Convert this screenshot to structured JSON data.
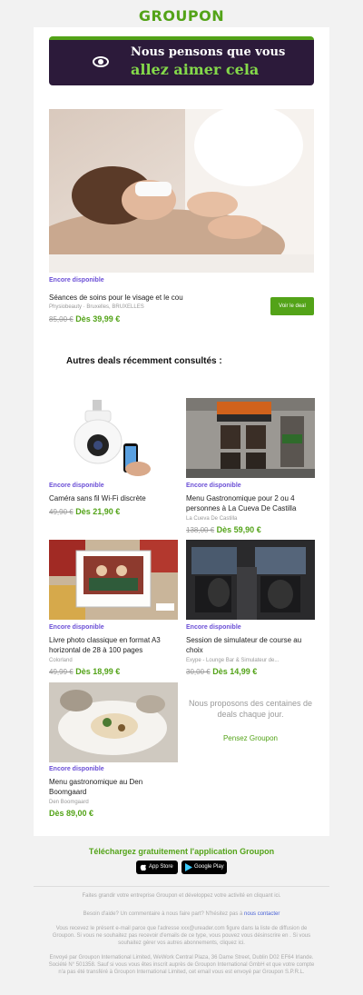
{
  "header": {
    "logo": "GROUPON"
  },
  "banner": {
    "line1": "Nous pensons que vous",
    "line2": "allez aimer cela",
    "icon": "eye-icon"
  },
  "hero_deal": {
    "availability": "Encore disponible",
    "title": "Séances de soins pour le visage et le cou",
    "merchant": "Physiobeauty · Bruxelles, BRUXELLES",
    "old_price": "85,00 €",
    "new_price": "Dès 39,99 €",
    "button": "Voir le deal"
  },
  "section_title": "Autres deals récemment consultés :",
  "deals": [
    {
      "availability": "Encore disponible",
      "title": "Caméra sans fil Wi-Fi discrète",
      "merchant": "",
      "old_price": "49,90 €",
      "new_price": "Dès 21,90 €"
    },
    {
      "availability": "Encore disponible",
      "title": "Menu Gastronomique pour 2 ou 4 personnes à La Cueva De Castilla",
      "merchant": "La Cueva De Castilla",
      "old_price": "138,00 €",
      "new_price": "Dès 59,90 €"
    },
    {
      "availability": "Encore disponible",
      "title": "Livre photo classique en format A3 horizontal de 28 à 100 pages",
      "merchant": "Colorland",
      "old_price": "49,99 €",
      "new_price": "Dès 18,99 €"
    },
    {
      "availability": "Encore disponible",
      "title": "Session de simulateur de course au choix",
      "merchant": "Exype - Lounge Bar & Simulateur de...",
      "old_price": "30,00 €",
      "new_price": "Dès 14,99 €"
    },
    {
      "availability": "Encore disponible",
      "title": "Menu gastronomique au Den Boomgaard",
      "merchant": "Den Boomgaard",
      "old_price": "",
      "new_price": "Dès 89,00 €"
    }
  ],
  "promo": {
    "text": "Nous proposons des centaines de deals chaque jour.",
    "link": "Pensez Groupon"
  },
  "app": {
    "title": "Téléchargez gratuitement l'application Groupon",
    "appstore": "App Store",
    "googleplay": "Google Play"
  },
  "footer": {
    "line1": "Faites grandir votre entreprise Groupon et développez votre activité en cliquant ici.",
    "help_prefix": "Besoin d'aide? Un commentaire à nous faire part? N'hésitez pas à",
    "help_link": "nous contacter",
    "legal1": "Vous recevez le présent e-mail parce que l'adresse xxx@ureader.com figure dans la liste de diffusion de Groupon. Si vous ne souhaitez pas recevoir d'emails de ce type, vous pouvez vous désinscrire en . Si vous souhaitez gérer vos autres abonnements, cliquez ici.",
    "legal2": "Envoyé par Groupon International Limited, WeWork Central Plaza, 36 Dame Street, Dublin D02 EF64 Irlande. Société N° 501358. Sauf si vous vous êtes inscrit auprès de Groupon International GmbH et que votre compte n'a pas été transféré à Groupon International Limited, cet email vous est envoyé par Groupon S.P.R.L."
  }
}
